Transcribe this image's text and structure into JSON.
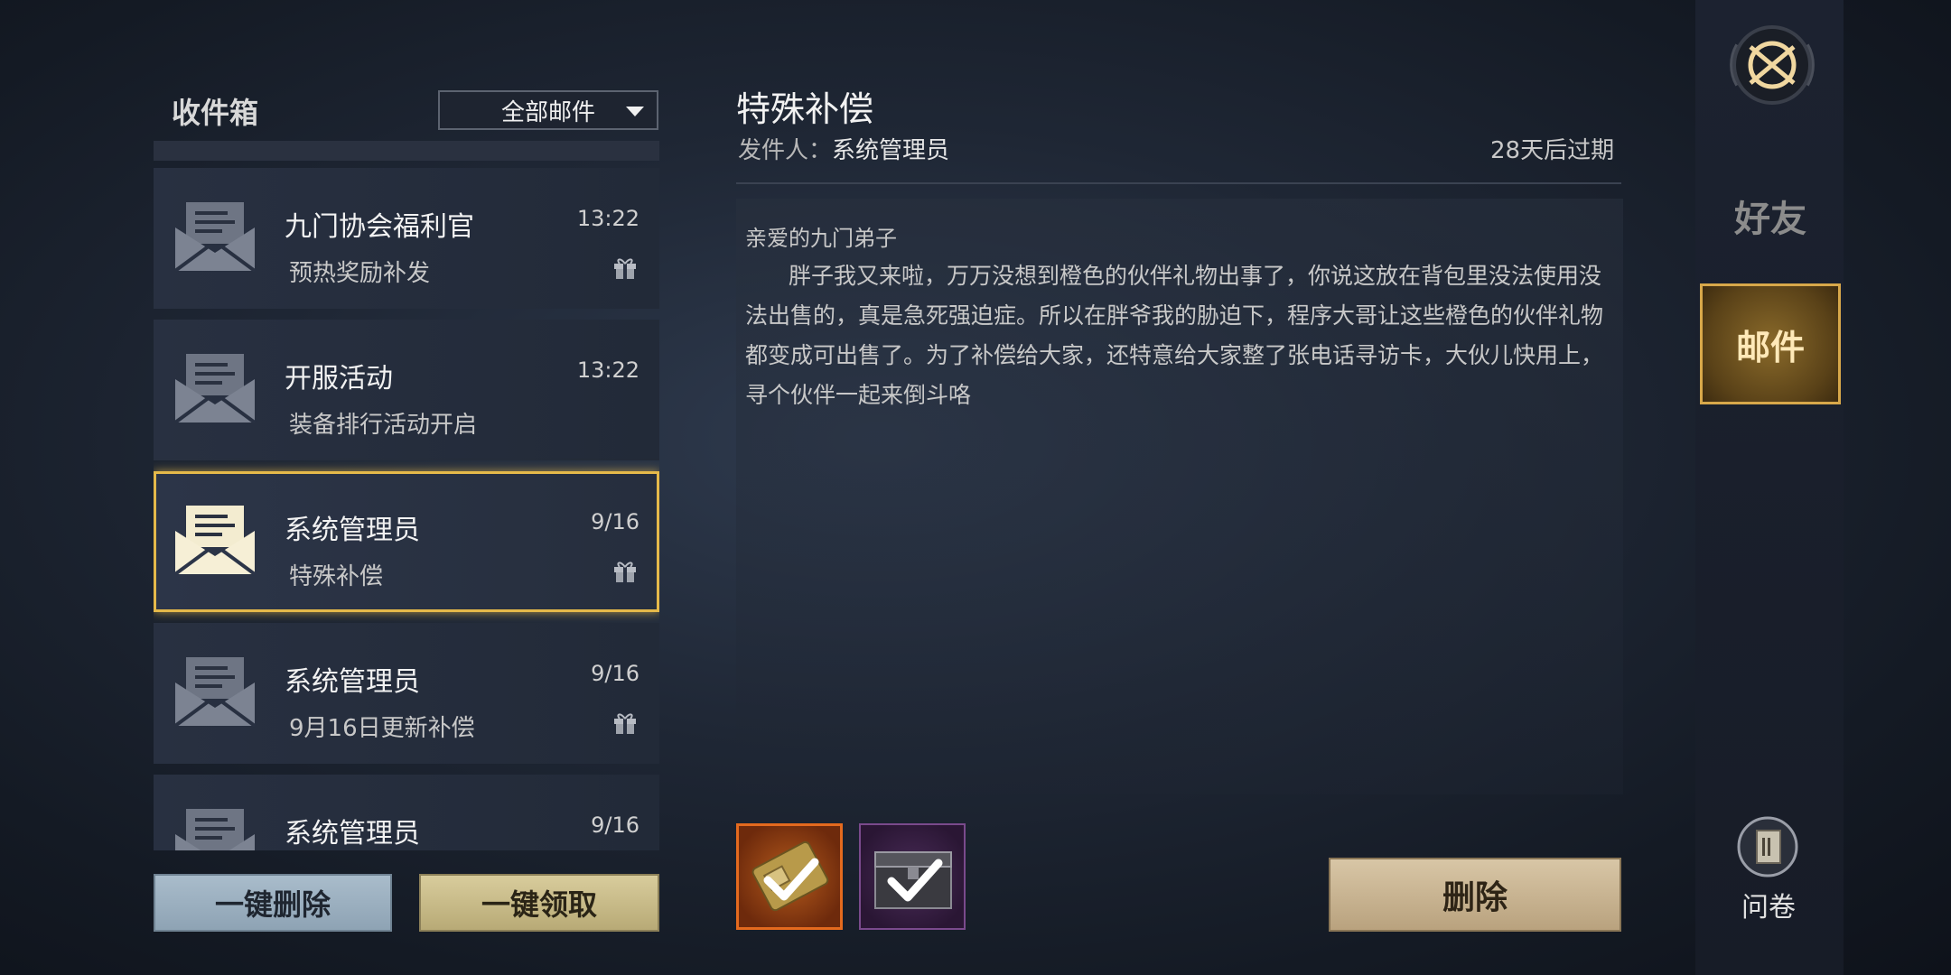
{
  "inbox": {
    "title": "收件箱",
    "filter_label": "全部邮件",
    "mails": [
      {
        "sender": "九门协会福利官",
        "time": "13:22",
        "subject": "预热奖励补发",
        "has_gift": true,
        "selected": false
      },
      {
        "sender": "开服活动",
        "time": "13:22",
        "subject": "装备排行活动开启",
        "has_gift": false,
        "selected": false
      },
      {
        "sender": "系统管理员",
        "time": "9/16",
        "subject": "特殊补偿",
        "has_gift": true,
        "selected": true
      },
      {
        "sender": "系统管理员",
        "time": "9/16",
        "subject": "9月16日更新补偿",
        "has_gift": true,
        "selected": false
      },
      {
        "sender": "系统管理员",
        "time": "9/16",
        "subject": "",
        "has_gift": false,
        "selected": false
      }
    ],
    "delete_all_label": "一键删除",
    "claim_all_label": "一键领取"
  },
  "detail": {
    "title": "特殊补偿",
    "sender_prefix": "发件人：",
    "sender_name": "系统管理员",
    "expiry": "28天后过期",
    "greeting": "亲爱的九门弟子",
    "body": "胖子我又来啦，万万没想到橙色的伙伴礼物出事了，你说这放在背包里没法使用没法出售的，真是急死强迫症。所以在胖爷我的胁迫下，程序大哥让这些橙色的伙伴礼物都变成可出售了。为了补偿给大家，还特意给大家整了张电话寻访卡，大伙儿快用上，寻个伙伴一起来倒斗咯",
    "attachments": [
      {
        "icon": "phone-card-icon",
        "rarity_color": "#e46a1e",
        "claimed": true
      },
      {
        "icon": "chest-icon",
        "rarity_color": "#7a4a8c",
        "claimed": true
      }
    ],
    "delete_label": "删除"
  },
  "side_nav": {
    "friends_label": "好友",
    "mail_label": "邮件",
    "survey_label": "问卷"
  },
  "colors": {
    "selected_border": "#e5b94a",
    "accent_gold": "#d8a84a"
  }
}
